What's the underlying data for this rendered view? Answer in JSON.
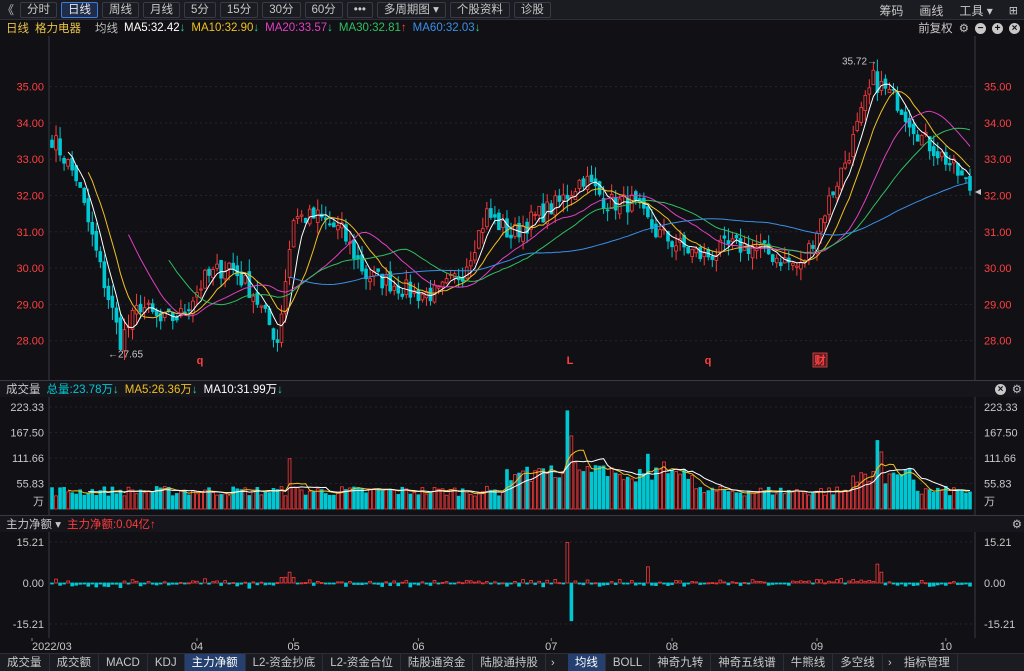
{
  "toolbar": {
    "back_icon": "double-chevron-left-icon",
    "buttons": [
      "分时",
      "日线",
      "周线",
      "月线",
      "5分",
      "15分",
      "30分",
      "60分",
      "•••",
      "多周期图 ▾",
      "个股资料",
      "诊股"
    ],
    "active_index": 1,
    "right": [
      "筹码",
      "画线",
      "工具 ▾"
    ]
  },
  "info": {
    "period": "日线",
    "stock": "格力电器",
    "label": "均线",
    "ma5": "MA5:32.42",
    "ma10": "MA10:32.90",
    "ma20": "MA20:33.57",
    "ma30": "MA30:32.81",
    "ma60": "MA60:32.03",
    "fuquan": "前复权"
  },
  "price_panel": {
    "y_ticks": [
      "35.00",
      "34.00",
      "33.00",
      "32.00",
      "31.00",
      "30.00",
      "29.00",
      "28.00"
    ],
    "low_label": "←27.65",
    "high_label": "35.72→",
    "markers": [
      "q",
      "L",
      "q",
      "财"
    ],
    "colors": {
      "up": "#ff3b3b",
      "down": "#00c8d2",
      "ma5": "#ffffff",
      "ma10": "#f0c020",
      "ma20": "#e040c0",
      "ma30": "#30c060",
      "ma60": "#3a90e8"
    }
  },
  "volume_panel": {
    "title": "成交量",
    "total": "总量:23.78万",
    "ma5": "MA5:26.36万",
    "ma10": "MA10:31.99万",
    "y_ticks": [
      "223.33",
      "167.50",
      "111.66",
      "55.83",
      "万"
    ]
  },
  "flow_panel": {
    "title": "主力净额 ▾",
    "value": "主力净额:0.04亿",
    "y_ticks": [
      "15.21",
      "0.00",
      "-15.21"
    ]
  },
  "x_axis": {
    "labels": [
      "2022/03",
      "04",
      "05",
      "06",
      "07",
      "08",
      "09",
      "10"
    ]
  },
  "bottom_tabs": {
    "left": [
      "成交量",
      "成交额",
      "MACD",
      "KDJ",
      "主力净额",
      "L2-资金抄底",
      "L2-资金合位",
      "陆股通资金",
      "陆股通持股"
    ],
    "left_active": 4,
    "right": [
      "均线",
      "BOLL",
      "神奇九转",
      "神奇五线谱",
      "牛熊线",
      "多空线"
    ],
    "right_active": 0,
    "last": "指标管理"
  }
}
